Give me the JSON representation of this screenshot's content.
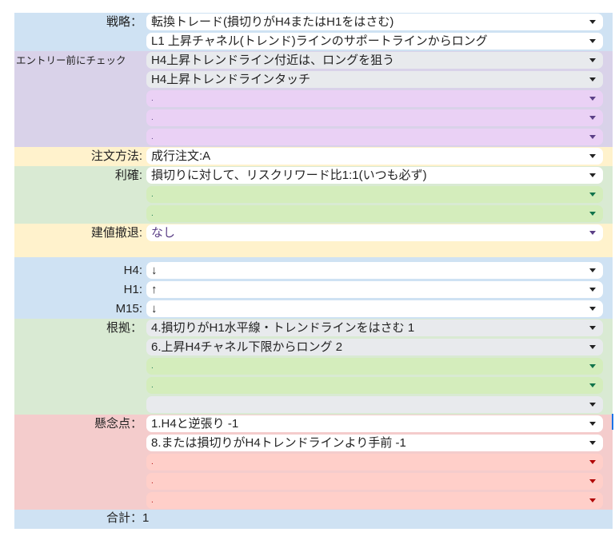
{
  "labels": {
    "strategy": "戦略：",
    "entry_check": "エントリー前にチェック",
    "order": "注文方法:",
    "take_profit": "利確:",
    "withdraw": "建値撤退:",
    "h4": "H4:",
    "h1": "H1:",
    "m15": "M15:",
    "basis": "根拠：",
    "concerns": "懸念点：",
    "total": "合計：",
    "total_value": "1"
  },
  "strategy": [
    "転換トレード(損切りがH4またはH1をはさむ)",
    "L1 上昇チャネル(トレンド)ラインのサポートラインからロング"
  ],
  "entry_check": [
    "H4上昇トレンドライン付近は、ロングを狙う",
    "H4上昇トレンドラインタッチ",
    ".",
    ".",
    "."
  ],
  "order": "成行注文:A",
  "take_profit": [
    "損切りに対して、リスクリワード比1:1(いつも必ず)",
    ".",
    "."
  ],
  "withdraw": "なし",
  "h4": "↓",
  "h1": "↑",
  "m15": "↓",
  "basis": [
    "4.損切りがH1水平線・トレンドラインをはさむ  1",
    "6.上昇H4チャネル下限からロング  2",
    ".",
    ".",
    ""
  ],
  "concerns": [
    "1.H4と逆張り  -1",
    "8.または損切りがH4トレンドラインより手前  -1",
    ".",
    ".",
    "."
  ],
  "colors": {
    "blue": "#cfe2f3",
    "purple": "#d9d2e9",
    "orange": "#fff2cc",
    "green": "#d9ead3",
    "red": "#f4cccc"
  }
}
